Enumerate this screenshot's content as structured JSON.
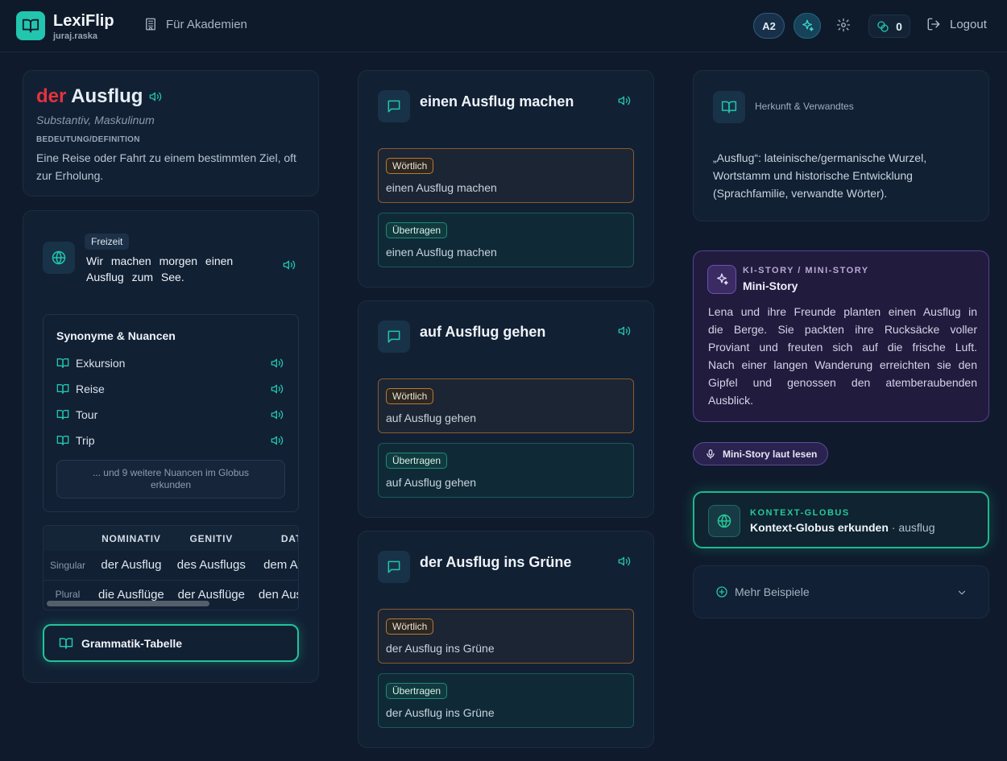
{
  "header": {
    "app_name": "LexiFlip",
    "user": "juraj.raska",
    "akademien": "Für Akademien",
    "level": "A2",
    "coins": "0",
    "logout": "Logout"
  },
  "word": {
    "article": "der",
    "noun": "Ausflug",
    "pos": "Substantiv, Maskulinum",
    "definition_caption": "BEDEUTUNG/DEFINITION",
    "definition": "Eine Reise oder Fahrt zu einem bestimmten Ziel, oft zur Erholung."
  },
  "example": {
    "tag": "Freizeit",
    "sentence": "Wir machen morgen einen Ausflug zum See."
  },
  "synonyms": {
    "title": "Synonyme & Nuancen",
    "items": [
      {
        "label": "Exkursion"
      },
      {
        "label": "Reise"
      },
      {
        "label": "Tour"
      },
      {
        "label": "Trip"
      }
    ],
    "more": "... und 9 weitere Nuancen im Globus erkunden"
  },
  "grammar": {
    "headers": [
      "NOMINATIV",
      "GENITIV",
      "DATIV"
    ],
    "rows": [
      {
        "label": "Singular",
        "cells": [
          "der Ausflug",
          "des Ausflugs",
          "dem Ausflug"
        ]
      },
      {
        "label": "Plural",
        "cells": [
          "die Ausflüge",
          "der Ausflüge",
          "den Ausflügen"
        ]
      }
    ],
    "button": "Grammatik-Tabelle"
  },
  "phrases": [
    {
      "title": "einen Ausflug machen",
      "literal_tag": "Wörtlich",
      "literal": "einen Ausflug machen",
      "figurative_tag": "Übertragen",
      "figurative": "einen Ausflug machen"
    },
    {
      "title": "auf Ausflug gehen",
      "literal_tag": "Wörtlich",
      "literal": "auf Ausflug gehen",
      "figurative_tag": "Übertragen",
      "figurative": "auf Ausflug gehen"
    },
    {
      "title": "der Ausflug ins Grüne",
      "literal_tag": "Wörtlich",
      "literal": "der Ausflug ins Grüne",
      "figurative_tag": "Übertragen",
      "figurative": "der Ausflug ins Grüne"
    }
  ],
  "etymology": {
    "title": "Herkunft & Verwandtes",
    "text": "„Ausflug“: lateinische/germanische Wurzel, Wortstamm und historische Entwicklung (Sprachfamilie, verwandte Wörter)."
  },
  "story": {
    "caption": "KI-STORY / MINI-STORY",
    "title": "Mini-Story",
    "text": "Lena und ihre Freunde planten einen Ausflug in die Berge. Sie packten ihre Rucksäcke voller Proviant und freuten sich auf die frische Luft. Nach einer langen Wanderung erreichten sie den Gipfel und genossen den atemberaubenden Ausblick.",
    "read_button": "Mini-Story laut lesen"
  },
  "globe": {
    "caption": "KONTEXT-GLOBUS",
    "title": "Kontext-Globus erkunden",
    "suffix": "· ausflug"
  },
  "more_examples": "Mehr Beispiele",
  "colors": {
    "accent": "#22c5ad",
    "article": "#e5323e",
    "story": "#5b3f91"
  }
}
